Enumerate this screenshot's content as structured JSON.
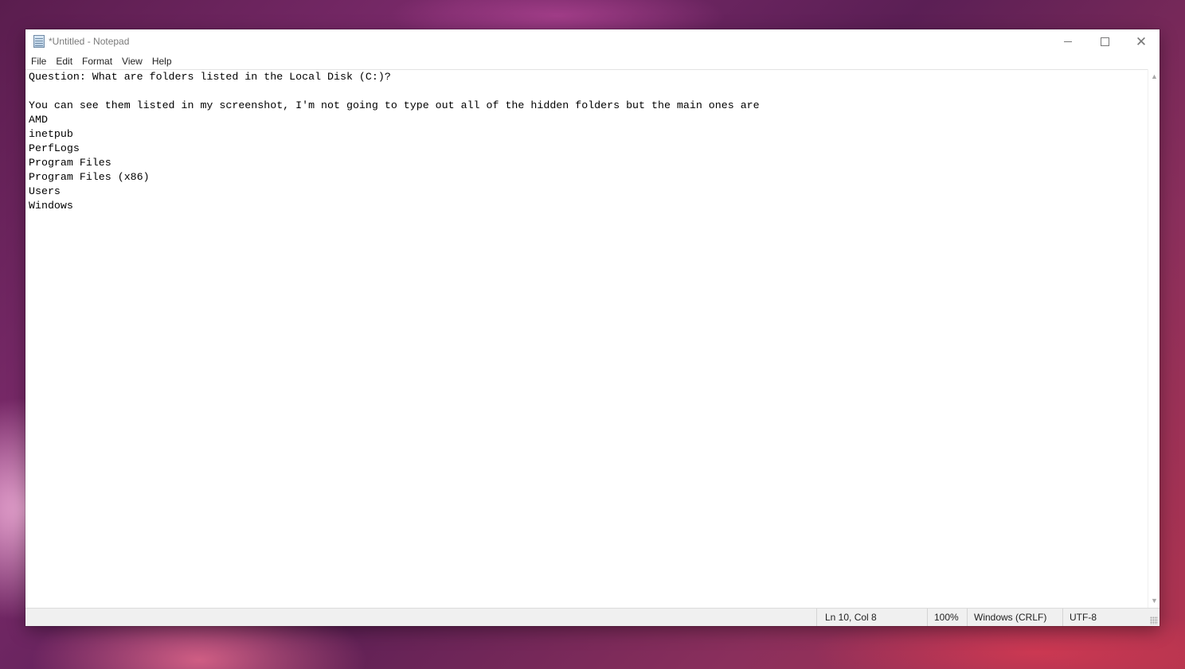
{
  "window": {
    "title": "*Untitled - Notepad",
    "icon": "notepad-icon",
    "controls": {
      "minimize": "minimize-icon",
      "maximize": "maximize-icon",
      "close": "close-icon"
    }
  },
  "menu": {
    "items": [
      "File",
      "Edit",
      "Format",
      "View",
      "Help"
    ]
  },
  "editor": {
    "content": "Question: What are folders listed in the Local Disk (C:)?\n\nYou can see them listed in my screenshot, I'm not going to type out all of the hidden folders but the main ones are\nAMD\ninetpub\nPerfLogs\nProgram Files\nProgram Files (x86)\nUsers\nWindows"
  },
  "status": {
    "position": "Ln 10, Col 8",
    "zoom": "100%",
    "line_ending": "Windows (CRLF)",
    "encoding": "UTF-8"
  }
}
